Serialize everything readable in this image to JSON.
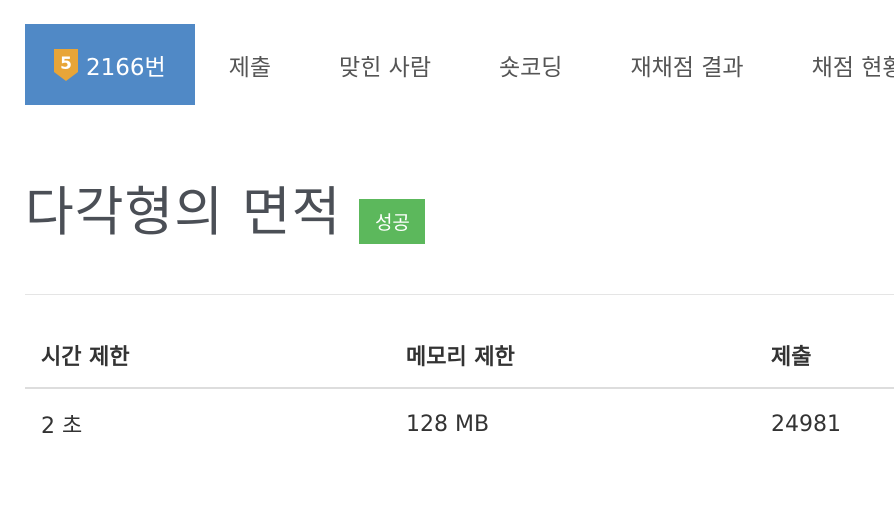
{
  "tabs": {
    "problem_tab": {
      "tier_level": "5",
      "label": "2166번"
    },
    "items": [
      {
        "label": "제출"
      },
      {
        "label": "맞힌 사람"
      },
      {
        "label": "숏코딩"
      },
      {
        "label": "재채점 결과"
      },
      {
        "label": "채점 현황"
      }
    ]
  },
  "problem": {
    "title": "다각형의 면적",
    "status_badge": "성공"
  },
  "info_table": {
    "headers": [
      "시간 제한",
      "메모리 제한",
      "제출"
    ],
    "row": [
      "2 초",
      "128 MB",
      "24981"
    ]
  },
  "colors": {
    "active_tab": "#5089c6",
    "tier_badge": "#e8a538",
    "success_badge": "#5cb85c",
    "title_text": "#4b4f56"
  },
  "icons": {
    "tier": "tier-shield-icon"
  }
}
